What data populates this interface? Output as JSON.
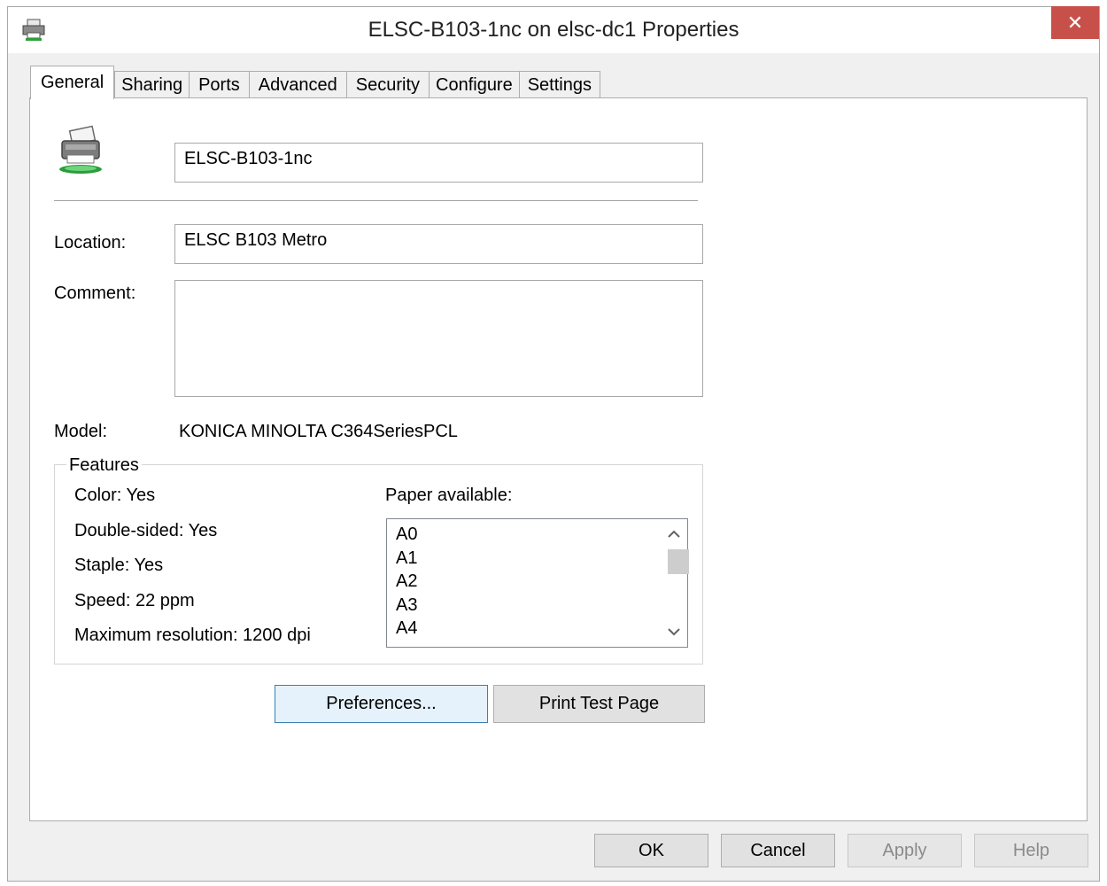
{
  "window": {
    "title": "ELSC-B103-1nc on elsc-dc1 Properties",
    "close_symbol": "✕"
  },
  "tabs": [
    {
      "label": "General",
      "active": true
    },
    {
      "label": "Sharing"
    },
    {
      "label": "Ports"
    },
    {
      "label": "Advanced"
    },
    {
      "label": "Security"
    },
    {
      "label": "Configure"
    },
    {
      "label": "Settings"
    }
  ],
  "general": {
    "printer_name": "ELSC-B103-1nc",
    "location_label": "Location:",
    "location_value": "ELSC B103 Metro",
    "comment_label": "Comment:",
    "comment_value": "",
    "model_label": "Model:",
    "model_value": "KONICA MINOLTA C364SeriesPCL"
  },
  "features": {
    "title": "Features",
    "color": "Color: Yes",
    "double_sided": "Double-sided: Yes",
    "staple": "Staple: Yes",
    "speed": "Speed: 22 ppm",
    "max_resolution": "Maximum resolution: 1200 dpi",
    "paper_label": "Paper available:",
    "paper_items": [
      "A0",
      "A1",
      "A2",
      "A3",
      "A4"
    ]
  },
  "actions": {
    "preferences": "Preferences...",
    "print_test_page": "Print Test Page"
  },
  "footer": {
    "ok": "OK",
    "cancel": "Cancel",
    "apply": "Apply",
    "help": "Help"
  },
  "colors": {
    "close_button": "#c7504a",
    "primary_border": "#3c7fb1"
  },
  "icons": {
    "title": "printer-icon",
    "printer": "network-printer-icon",
    "scroll_up": "chevron-up-icon",
    "scroll_down": "chevron-down-icon"
  }
}
